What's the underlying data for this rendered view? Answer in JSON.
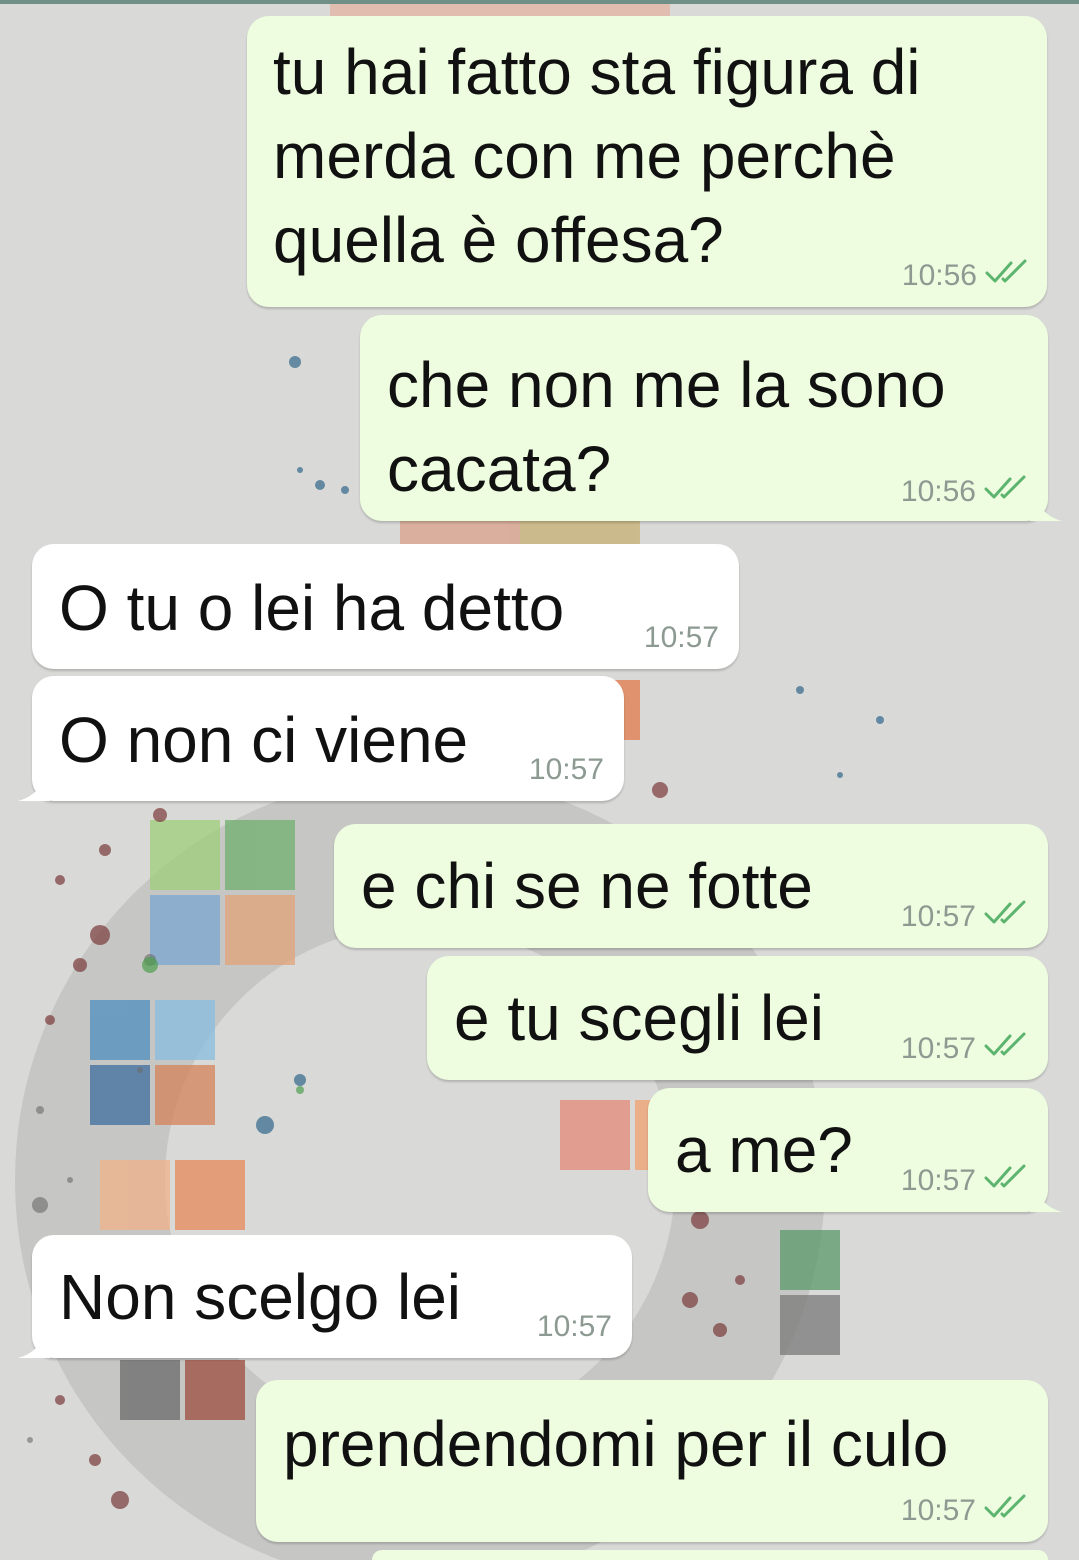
{
  "chat": {
    "messages": [
      {
        "direction": "out",
        "lines": "tu hai fatto sta figura di\nmerda con me perchè\nquella è offesa?",
        "time": "10:56",
        "status_icon": "double-check-icon"
      },
      {
        "direction": "out",
        "lines": "che non me la sono\ncacata?",
        "time": "10:56",
        "status_icon": "double-check-icon"
      },
      {
        "direction": "in",
        "lines": "O tu o lei ha detto",
        "time": "10:57"
      },
      {
        "direction": "in",
        "lines": "O non ci viene",
        "time": "10:57"
      },
      {
        "direction": "out",
        "lines": "e chi se ne fotte",
        "time": "10:57",
        "status_icon": "double-check-icon"
      },
      {
        "direction": "out",
        "lines": "e tu scegli lei",
        "time": "10:57",
        "status_icon": "double-check-icon"
      },
      {
        "direction": "out",
        "lines": "a me?",
        "time": "10:57",
        "status_icon": "double-check-icon"
      },
      {
        "direction": "in",
        "lines": "Non scelgo lei",
        "time": "10:57"
      },
      {
        "direction": "out",
        "lines": "prendendomi per il culo",
        "time": "10:57",
        "status_icon": "double-check-icon"
      }
    ]
  },
  "colors": {
    "outgoing_bubble": "#eefde0",
    "incoming_bubble": "#ffffff",
    "time_text": "#8c9a92",
    "check_marks": "#5cb46f",
    "wallpaper": "#d9d9d7"
  }
}
